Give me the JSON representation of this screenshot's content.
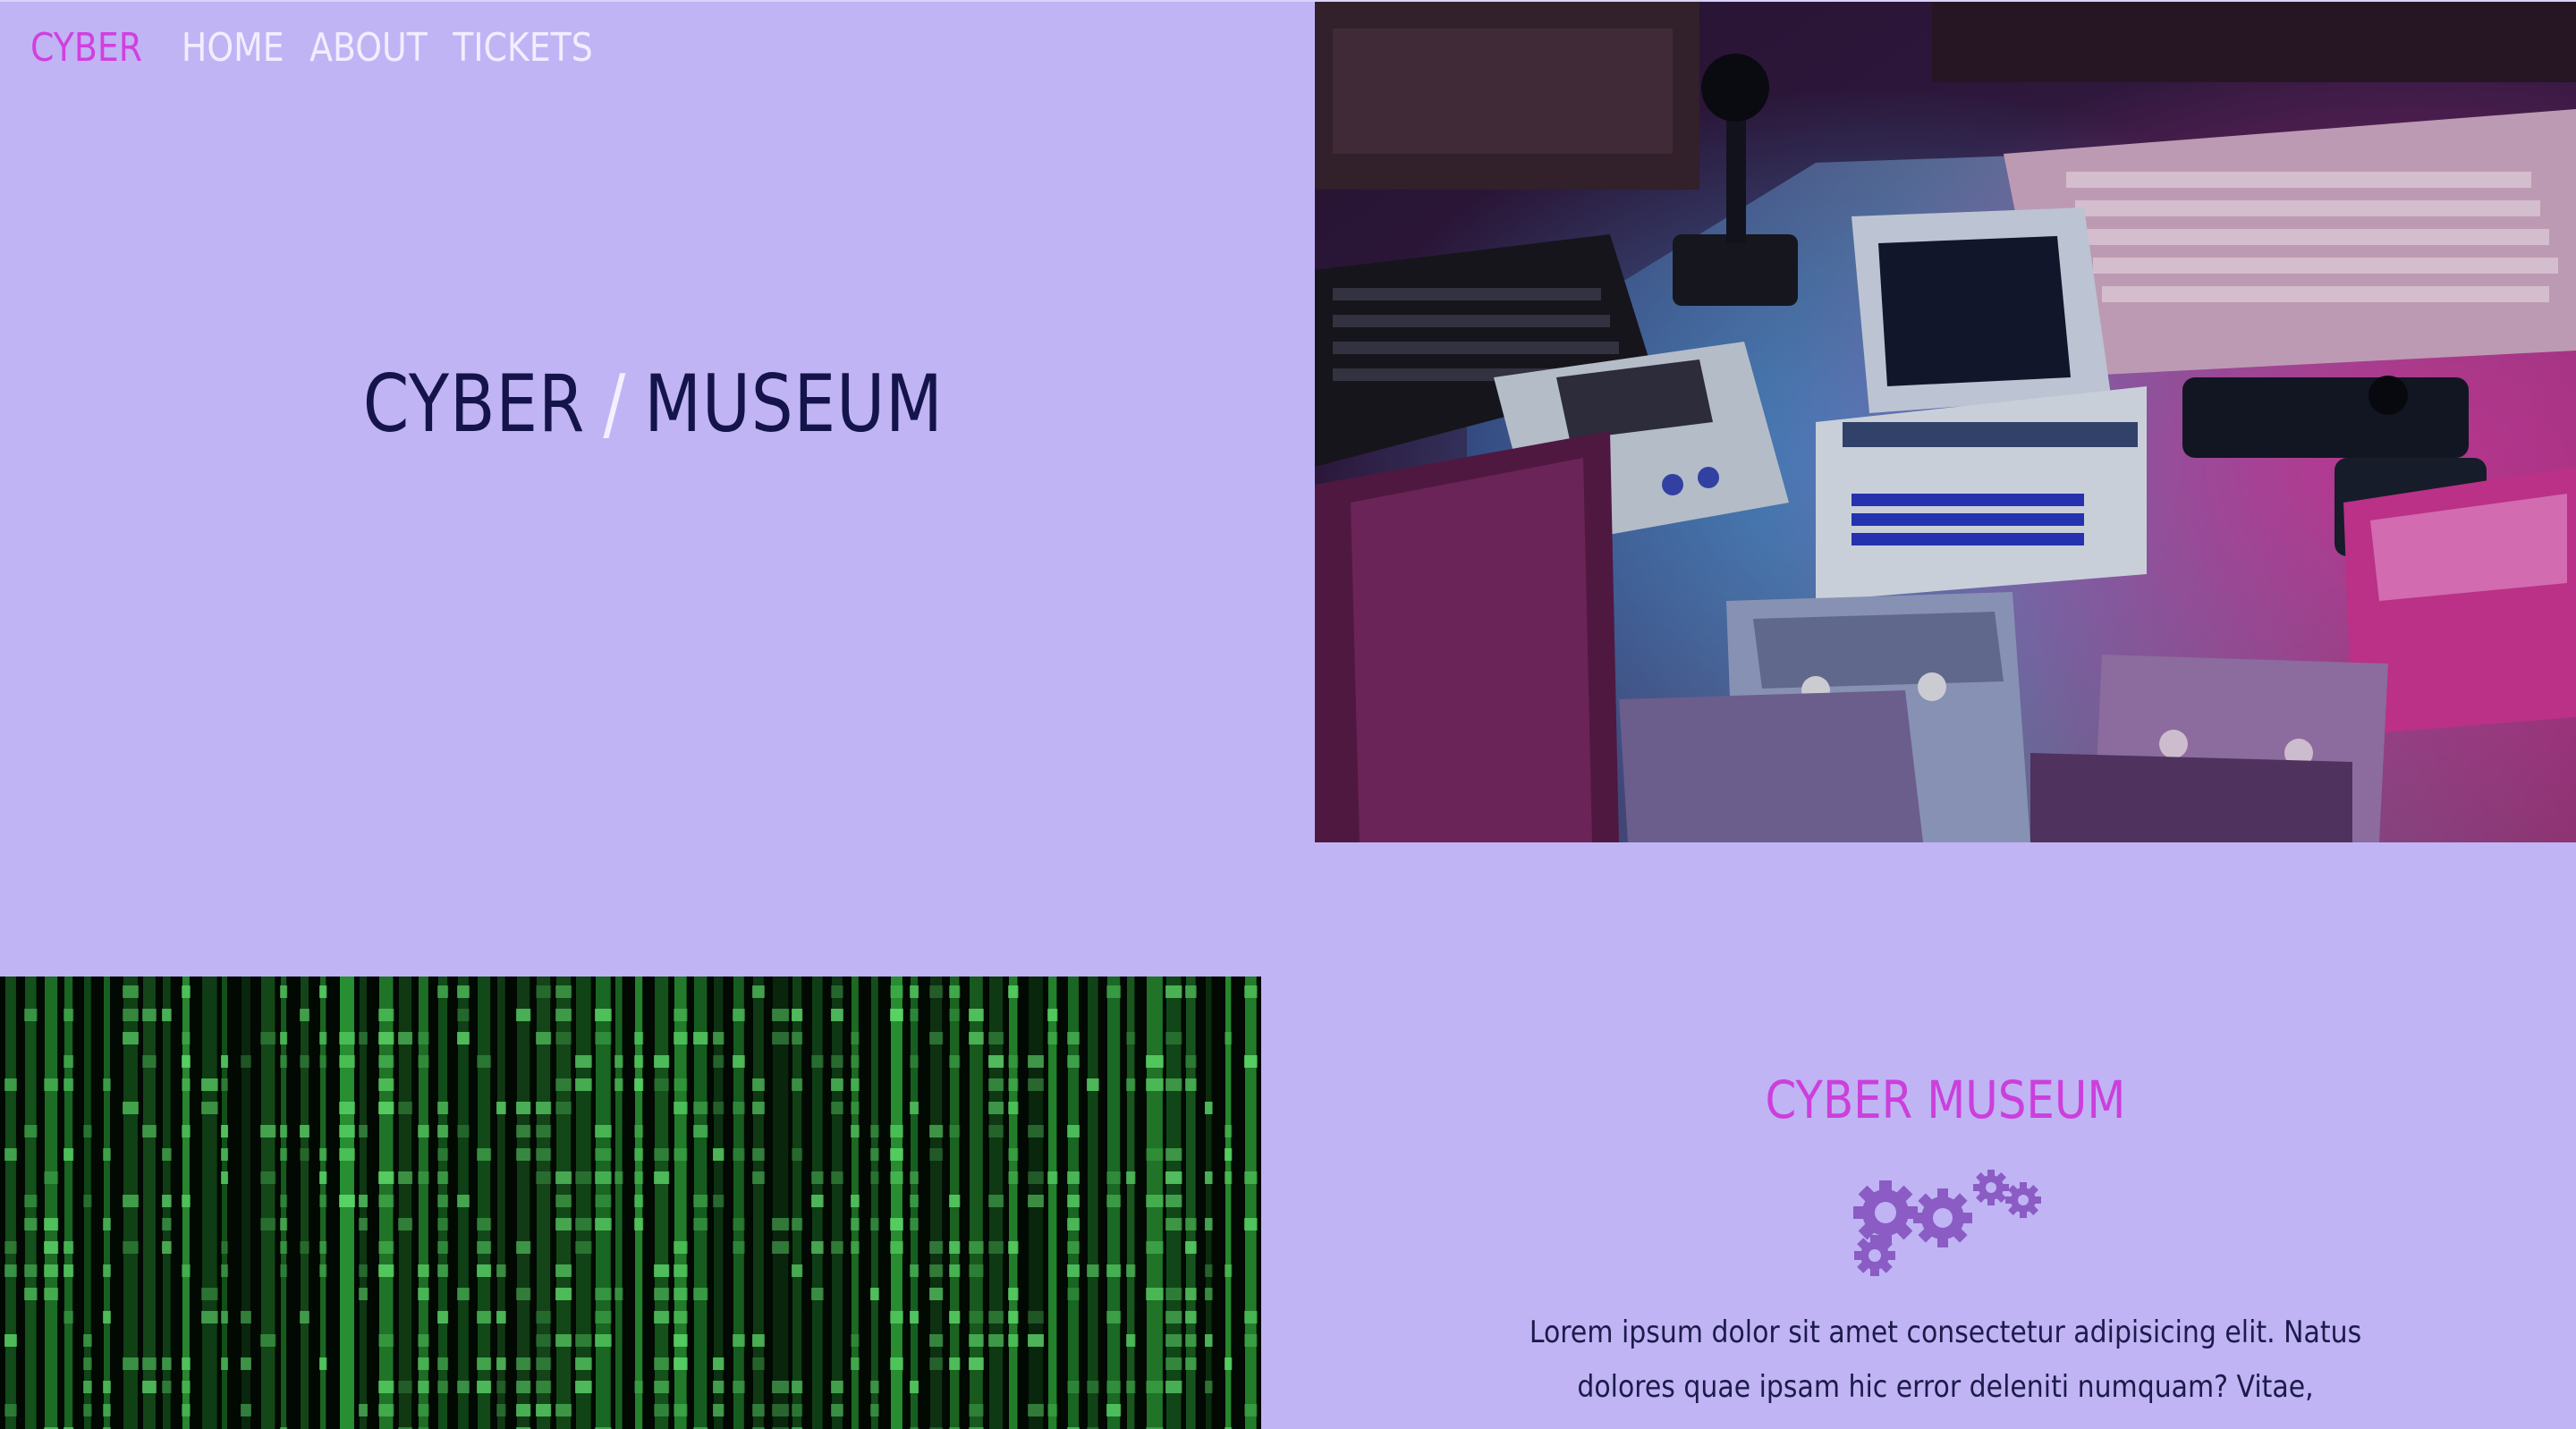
{
  "nav": {
    "brand": "CYBER",
    "links": [
      "HOME",
      "ABOUT",
      "TICKETS"
    ]
  },
  "hero": {
    "title_left": "CYBER",
    "title_separator": "/",
    "title_right": "MUSEUM"
  },
  "info": {
    "title": "CYBER MUSEUM",
    "icon": "gears-icon",
    "text": "Lorem ipsum dolor sit amet consectetur adipisicing elit. Natus dolores quae ipsam hic error deleniti numquam? Vitae,"
  },
  "images": {
    "retro": "retro-computers-image",
    "matrix": "matrix-code-image"
  },
  "colors": {
    "background": "#c0b4f5",
    "accent": "#cc3fdc",
    "nav_link": "#f2eeff",
    "title": "#14144a",
    "gear": "#8a5cc4"
  }
}
